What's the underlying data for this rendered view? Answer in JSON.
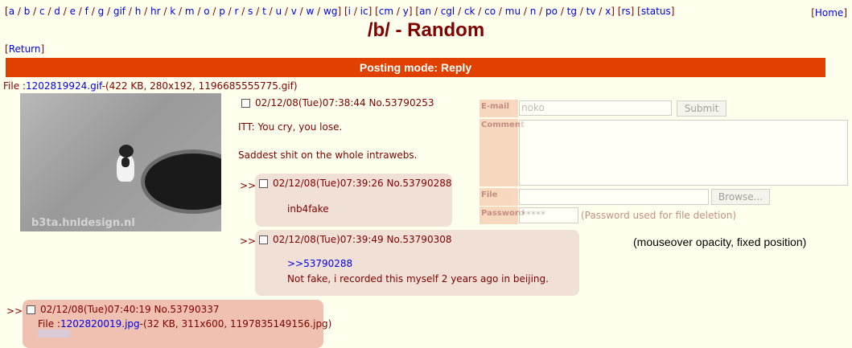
{
  "nav": {
    "groups": [
      [
        "a",
        "b",
        "c",
        "d",
        "e",
        "f",
        "g",
        "gif",
        "h",
        "hr",
        "k",
        "m",
        "o",
        "p",
        "r",
        "s",
        "t",
        "u",
        "v",
        "w",
        "wg"
      ],
      [
        "i",
        "ic"
      ],
      [
        "cm",
        "y"
      ],
      [
        "an",
        "cgl",
        "ck",
        "co",
        "mu",
        "n",
        "po",
        "tg",
        "tv",
        "x"
      ],
      [
        "rs"
      ],
      [
        "status"
      ]
    ],
    "home": "Home"
  },
  "board": {
    "title": "/b/ - Random"
  },
  "return_label": "Return",
  "posting_mode": "Posting mode: Reply",
  "op": {
    "file_label": "File :",
    "file_name": "1202819924.gif",
    "file_meta": "-(422 KB, 280x192, 1196685555775.gif)",
    "image_watermark": "b3ta.hnldesign.nl",
    "date": "02/12/08(Tue)07:38:44",
    "post_no": "No.53790253",
    "text_line1": "ITT: You cry, you lose.",
    "text_line2": "Saddest shit on the whole intrawebs."
  },
  "replies": [
    {
      "arrows": ">>",
      "date": "02/12/08(Tue)07:39:26",
      "post_no": "No.53790288",
      "text": "inb4fake"
    },
    {
      "arrows": ">>",
      "date": "02/12/08(Tue)07:39:49",
      "post_no": "No.53790308",
      "quote": ">>53790288",
      "text": "Not fake, i recorded this myself 2 years ago in beijing."
    },
    {
      "arrows": ">>",
      "date": "02/12/08(Tue)07:40:19",
      "post_no": "No.53790337",
      "file_label": "File :",
      "file_name": "1202820019.jpg",
      "file_meta": "-(32 KB, 311x600, 1197835149156.jpg)"
    }
  ],
  "form": {
    "email_label": "E-mail",
    "email_value": "noko",
    "submit_label": "Submit",
    "comment_label": "Comment",
    "file_label": "File",
    "browse_label": "Browse...",
    "password_label": "Password",
    "password_value": "*****",
    "password_hint": "(Password used for file deletion)"
  },
  "annotation": "(mouseover opacity, fixed position)"
}
